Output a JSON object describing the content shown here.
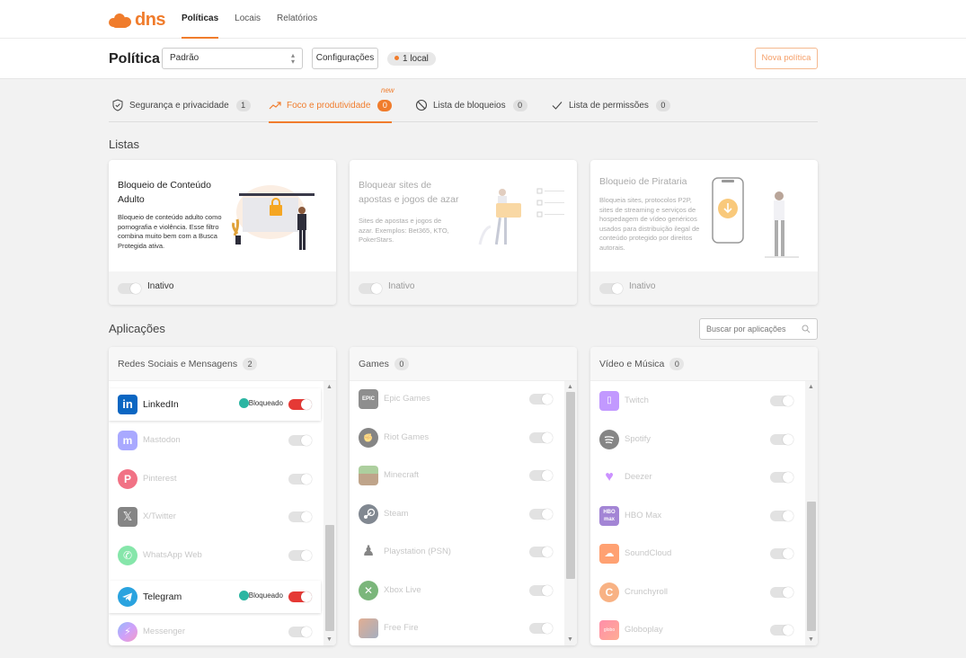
{
  "brand": {
    "name": "dns"
  },
  "nav": {
    "items": [
      {
        "label": "Políticas",
        "active": true
      },
      {
        "label": "Locais",
        "active": false
      },
      {
        "label": "Relatórios",
        "active": false
      }
    ]
  },
  "policy": {
    "title": "Política",
    "selected": "Padrão",
    "config_label": "Configurações",
    "local_badge": "1 local",
    "new_button": "Nova política"
  },
  "tabs": [
    {
      "label": "Segurança e privacidade",
      "count": "1",
      "icon": "shield-check-icon"
    },
    {
      "label": "Foco e produtividade",
      "count": "0",
      "icon": "trend-up-icon",
      "active": true,
      "tag": "new"
    },
    {
      "label": "Lista de bloqueios",
      "count": "0",
      "icon": "block-icon"
    },
    {
      "label": "Lista de permissões",
      "count": "0",
      "icon": "check-icon"
    }
  ],
  "lists": {
    "title": "Listas",
    "cards": [
      {
        "title": "Bloqueio de Conteúdo Adulto",
        "desc": "Bloqueio de conteúdo adulto como pornografia e violência. Esse filtro combina muito bem com a Busca Protegida ativa.",
        "state": "Inativo"
      },
      {
        "title": "Bloquear sites de apostas e jogos de azar",
        "desc": "Sites de apostas e jogos de azar. Exemplos: Bet365, KTO, PokerStars.",
        "state": "Inativo"
      },
      {
        "title": "Bloqueio de Pirataria",
        "desc": "Bloqueia sites, protocolos P2P, sites de streaming e serviços de hospedagem de vídeo genéricos usados para distribuição ilegal de conteúdo protegido por direitos autorais.",
        "state": "Inativo"
      }
    ]
  },
  "apps": {
    "title": "Aplicações",
    "search_placeholder": "Buscar por aplicações",
    "blocked_label": "Bloqueado",
    "panels": [
      {
        "title": "Redes Sociais e Mensagens",
        "count": "2",
        "items": [
          {
            "name": "LinkedIn",
            "blocked": true,
            "icon": "linkedin-icon",
            "color": "#0a66c2"
          },
          {
            "name": "Mastodon",
            "blocked": false,
            "icon": "mastodon-icon",
            "color": "#6364ff"
          },
          {
            "name": "Pinterest",
            "blocked": false,
            "icon": "pinterest-icon",
            "color": "#e60023"
          },
          {
            "name": "X/Twitter",
            "blocked": false,
            "icon": "x-icon",
            "color": "#222222"
          },
          {
            "name": "WhatsApp Web",
            "blocked": false,
            "icon": "whatsapp-icon",
            "color": "#25d366"
          },
          {
            "name": "Telegram",
            "blocked": true,
            "icon": "telegram-icon",
            "color": "#2aa3df"
          },
          {
            "name": "Messenger",
            "blocked": false,
            "icon": "messenger-icon",
            "color": "#7b61ff"
          }
        ]
      },
      {
        "title": "Games",
        "count": "0",
        "items": [
          {
            "name": "Epic Games",
            "blocked": false,
            "icon": "epic-games-icon",
            "color": "#333333"
          },
          {
            "name": "Riot Games",
            "blocked": false,
            "icon": "riot-games-icon",
            "color": "#222222"
          },
          {
            "name": "Minecraft",
            "blocked": false,
            "icon": "minecraft-icon",
            "color": "#6aa84f"
          },
          {
            "name": "Steam",
            "blocked": false,
            "icon": "steam-icon",
            "color": "#1b2838"
          },
          {
            "name": "Playstation (PSN)",
            "blocked": false,
            "icon": "playstation-icon",
            "color": "#222222"
          },
          {
            "name": "Xbox Live",
            "blocked": false,
            "icon": "xbox-icon",
            "color": "#107c10"
          },
          {
            "name": "Free Fire",
            "blocked": false,
            "icon": "free-fire-icon",
            "color": "#c96c3a"
          }
        ]
      },
      {
        "title": "Vídeo e Música",
        "count": "0",
        "items": [
          {
            "name": "Twitch",
            "blocked": false,
            "icon": "twitch-icon",
            "color": "#9146ff"
          },
          {
            "name": "Spotify",
            "blocked": false,
            "icon": "spotify-icon",
            "color": "#222222"
          },
          {
            "name": "Deezer",
            "blocked": false,
            "icon": "deezer-icon",
            "color": "#a238ff"
          },
          {
            "name": "HBO Max",
            "blocked": false,
            "icon": "hbo-max-icon",
            "color": "#5822b4"
          },
          {
            "name": "SoundCloud",
            "blocked": false,
            "icon": "soundcloud-icon",
            "color": "#ff5500"
          },
          {
            "name": "Crunchyroll",
            "blocked": false,
            "icon": "crunchyroll-icon",
            "color": "#f47521"
          },
          {
            "name": "Globoplay",
            "blocked": false,
            "icon": "globoplay-icon",
            "color": "#ff3366"
          }
        ]
      }
    ]
  },
  "colors": {
    "accent": "#f07c2c",
    "blocked_toggle": "#e53935",
    "clock": "#2bb5a2"
  }
}
